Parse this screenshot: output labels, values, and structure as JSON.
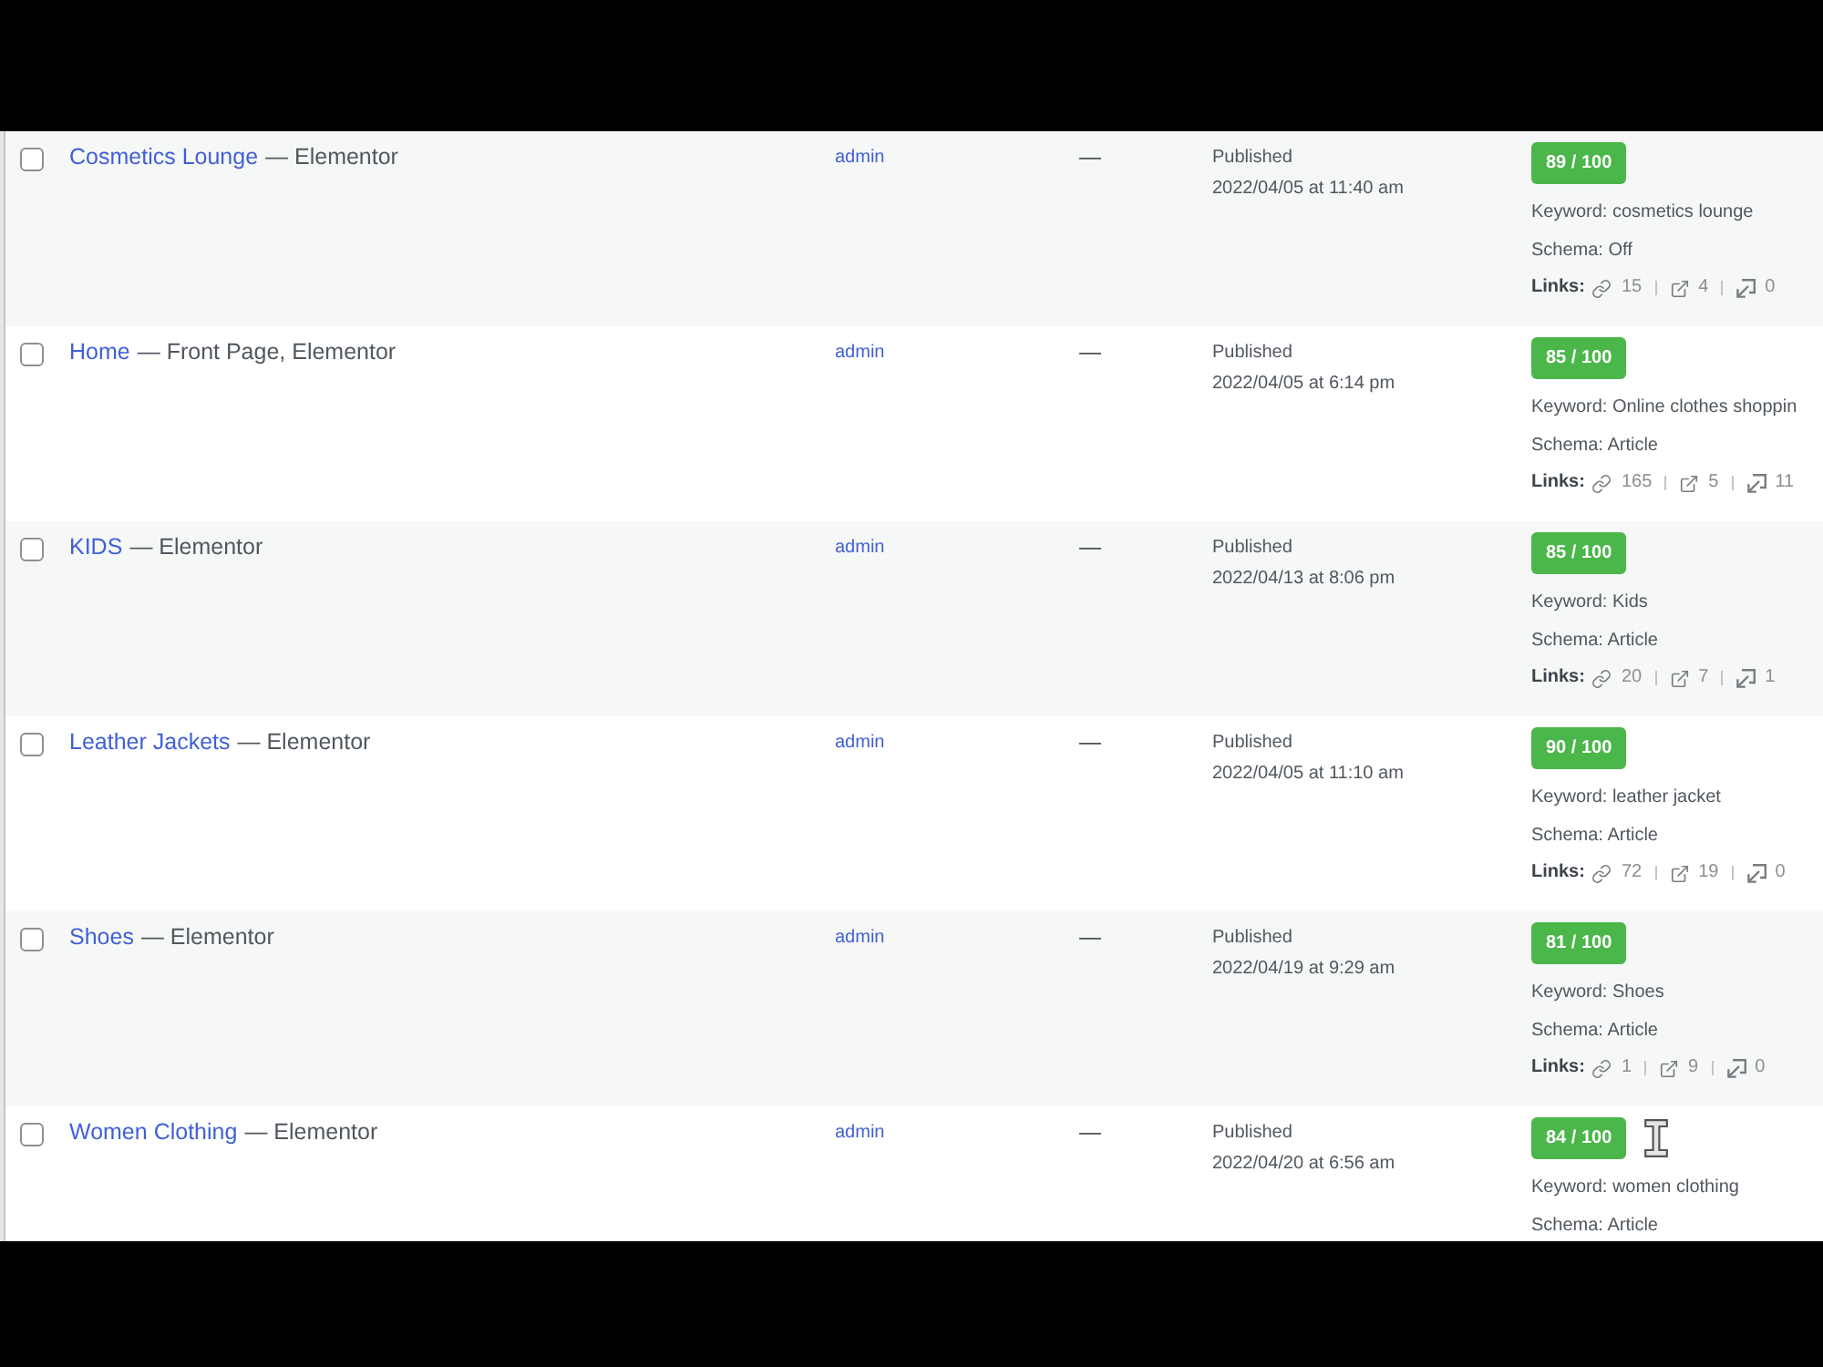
{
  "rows": [
    {
      "checked": false,
      "title": "Cosmetics Lounge",
      "states": "— Elementor",
      "author": "admin",
      "column_4": "—",
      "status": "Published",
      "date": "2022/04/05 at 11:40 am",
      "score": "89 / 100",
      "keyword": "Keyword: cosmetics lounge",
      "schema": "Schema: Off",
      "links": {
        "label": "Links:",
        "internal": "15",
        "external": "4",
        "incoming": "0"
      }
    },
    {
      "checked": false,
      "title": "Home",
      "states": "— Front Page, Elementor",
      "author": "admin",
      "column_4": "—",
      "status": "Published",
      "date": "2022/04/05 at 6:14 pm",
      "score": "85 / 100",
      "keyword": "Keyword: Online clothes shoppin",
      "schema": "Schema: Article",
      "links": {
        "label": "Links:",
        "internal": "165",
        "external": "5",
        "incoming": "11"
      }
    },
    {
      "checked": false,
      "title": "KIDS",
      "states": "— Elementor",
      "author": "admin",
      "column_4": "—",
      "status": "Published",
      "date": "2022/04/13 at 8:06 pm",
      "score": "85 / 100",
      "keyword": "Keyword: Kids",
      "schema": "Schema: Article",
      "links": {
        "label": "Links:",
        "internal": "20",
        "external": "7",
        "incoming": "1"
      }
    },
    {
      "checked": false,
      "title": "Leather Jackets",
      "states": "— Elementor",
      "author": "admin",
      "column_4": "—",
      "status": "Published",
      "date": "2022/04/05 at 11:10 am",
      "score": "90 / 100",
      "keyword": "Keyword: leather jacket",
      "schema": "Schema: Article",
      "links": {
        "label": "Links:",
        "internal": "72",
        "external": "19",
        "incoming": "0"
      }
    },
    {
      "checked": false,
      "title": "Shoes",
      "states": "— Elementor",
      "author": "admin",
      "column_4": "—",
      "status": "Published",
      "date": "2022/04/19 at 9:29 am",
      "score": "81 / 100",
      "keyword": "Keyword: Shoes",
      "schema": "Schema: Article",
      "links": {
        "label": "Links:",
        "internal": "1",
        "external": "9",
        "incoming": "0"
      }
    },
    {
      "checked": false,
      "title": "Women Clothing",
      "states": "— Elementor",
      "author": "admin",
      "column_4": "—",
      "status": "Published",
      "date": "2022/04/20 at 6:56 am",
      "score": "84 / 100",
      "mouse_cursor": {
        "kind": "text"
      },
      "keyword": "Keyword: women clothing",
      "schema": "Schema: Article"
    }
  ]
}
